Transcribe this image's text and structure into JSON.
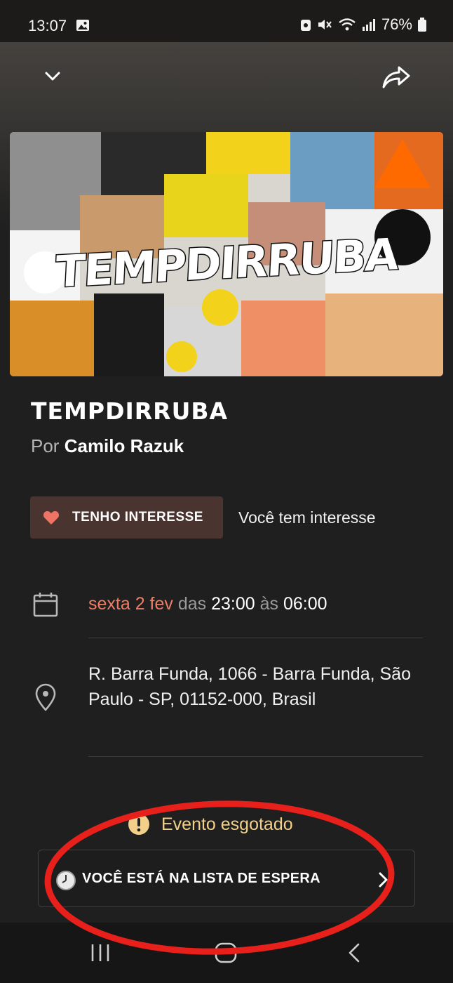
{
  "status_bar": {
    "time": "13:07",
    "battery": "76%",
    "icons": [
      "gallery-icon",
      "lock-icon",
      "mute-icon",
      "wifi-icon",
      "signal-icon",
      "battery-icon"
    ]
  },
  "header": {
    "back_icon": "chevron-down-icon",
    "share_icon": "share-icon"
  },
  "cover": {
    "artwork_text": "TEMPDIRRUBA"
  },
  "event": {
    "title": "TEMPDIRRUBA",
    "organizer_prefix": "Por",
    "organizer_name": "Camilo Razuk"
  },
  "interest": {
    "button_label": "TENHO INTERESSE",
    "status_text": "Você tem interesse"
  },
  "date": {
    "day": "sexta 2 fev",
    "from_word": "das",
    "start": "23:00",
    "to_word": "às",
    "end": "06:00"
  },
  "location": {
    "address": "R. Barra Funda, 1066 - Barra Funda, São Paulo - SP, 01152-000, Brasil"
  },
  "sold_out": {
    "text": "Evento esgotado"
  },
  "waitlist": {
    "label": "VOCÊ ESTÁ NA LISTA DE ESPERA"
  },
  "colors": {
    "accent": "#ee7d63",
    "interest_bg": "#4a3430",
    "heart": "#f07466",
    "warning": "#f2d08a",
    "annotation": "#e8201b"
  }
}
